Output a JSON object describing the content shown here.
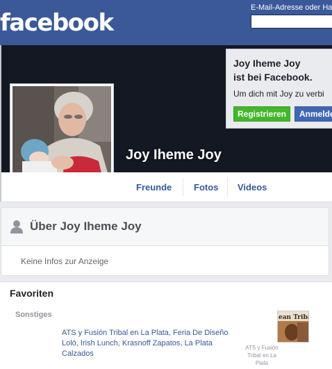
{
  "header": {
    "logo": "facebook",
    "login_label": "E-Mail-Adresse oder Ha",
    "login_value": ""
  },
  "signup": {
    "title_line1": "Joy Iheme Joy",
    "title_line2": "ist bei Facebook.",
    "text": "Um dich mit Joy zu verbi",
    "register_label": "Registrieren",
    "login_label": "Anmelde"
  },
  "profile": {
    "name": "Joy Iheme Joy"
  },
  "nav": {
    "tabs": [
      "Freunde",
      "Fotos",
      "Videos"
    ]
  },
  "about": {
    "title": "Über Joy Iheme Joy",
    "empty_text": "Keine Infos zur Anzeige"
  },
  "favorites": {
    "title": "Favoriten",
    "category": "Sonstiges",
    "links": [
      "ATS y Fusión Tribal en La Plata",
      "Feria De Diseño Loló",
      "Irish Lunch",
      "Krasnoff Zapatos",
      "La Plata Calzados"
    ],
    "thumb_caption": "ATS y Fusión Tribal en La Plata",
    "thumb_text": "ean Tribal"
  },
  "colors": {
    "brand_blue": "#3b5998",
    "register_green": "#42b72a",
    "login_blue": "#4267b2",
    "link_blue": "#365899"
  }
}
